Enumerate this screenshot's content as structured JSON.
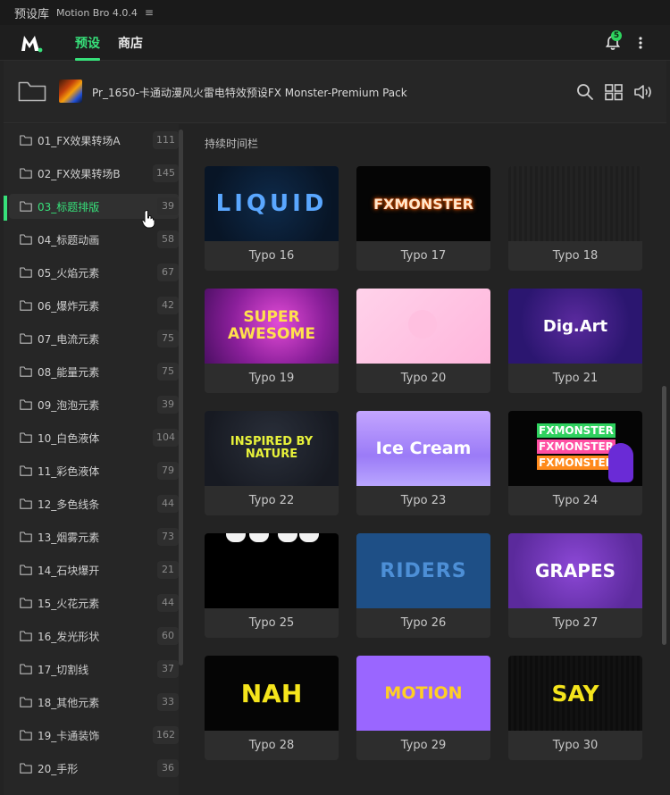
{
  "window": {
    "app_name": "预设库",
    "product": "Motion Bro 4.0.4",
    "menu_glyph": "≡"
  },
  "appbar": {
    "tabs": [
      {
        "label": "预设",
        "active": true
      },
      {
        "label": "商店",
        "active": false
      }
    ],
    "notification_count": "5",
    "accent_color": "#37e07a"
  },
  "pack": {
    "title": "Pr_1650-卡通动漫风火雷电特效预设FX Monster-Premium Pack"
  },
  "sidebar": {
    "items": [
      {
        "label": "01_FX效果转场A",
        "count": "111"
      },
      {
        "label": "02_FX效果转场B",
        "count": "145"
      },
      {
        "label": "03_标题排版",
        "count": "39",
        "active": true
      },
      {
        "label": "04_标题动画",
        "count": "58"
      },
      {
        "label": "05_火焰元素",
        "count": "67"
      },
      {
        "label": "06_爆炸元素",
        "count": "42"
      },
      {
        "label": "07_电流元素",
        "count": "75"
      },
      {
        "label": "08_能量元素",
        "count": "75"
      },
      {
        "label": "09_泡泡元素",
        "count": "39"
      },
      {
        "label": "10_白色液体",
        "count": "104"
      },
      {
        "label": "11_彩色液体",
        "count": "79"
      },
      {
        "label": "12_多色线条",
        "count": "44"
      },
      {
        "label": "13_烟雾元素",
        "count": "73"
      },
      {
        "label": "14_石块爆开",
        "count": "21"
      },
      {
        "label": "15_火花元素",
        "count": "44"
      },
      {
        "label": "16_发光形状",
        "count": "60"
      },
      {
        "label": "17_切割线",
        "count": "37"
      },
      {
        "label": "18_其他元素",
        "count": "33"
      },
      {
        "label": "19_卡通装饰",
        "count": "162"
      },
      {
        "label": "20_手形",
        "count": "36"
      }
    ]
  },
  "main": {
    "section_title": "持续时间栏",
    "cards": [
      {
        "name": "Typo 16",
        "art": "LIQUID"
      },
      {
        "name": "Typo 17",
        "art": "FXMONSTER"
      },
      {
        "name": "Typo 18",
        "art": ""
      },
      {
        "name": "Typo 19",
        "art": "SUPER AWESOME"
      },
      {
        "name": "Typo 20",
        "art": ""
      },
      {
        "name": "Typo 21",
        "art": "Dig.Art"
      },
      {
        "name": "Typo 22",
        "art": "INSPIRED BY NATURE"
      },
      {
        "name": "Typo 23",
        "art": "Ice Cream"
      },
      {
        "name": "Typo 24",
        "art": "FXMONSTER"
      },
      {
        "name": "Typo 25",
        "art": ""
      },
      {
        "name": "Typo 26",
        "art": "RIDERS"
      },
      {
        "name": "Typo 27",
        "art": "GRAPES"
      },
      {
        "name": "Typo 28",
        "art": "NAH"
      },
      {
        "name": "Typo 29",
        "art": "MOTION"
      },
      {
        "name": "Typo 30",
        "art": "SAY"
      }
    ]
  }
}
